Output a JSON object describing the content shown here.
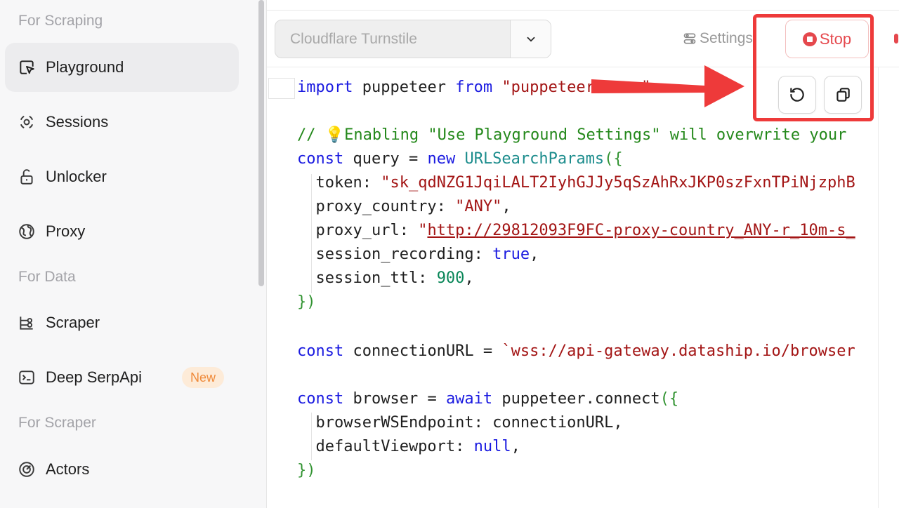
{
  "sidebar": {
    "sections": {
      "scraping": "For Scraping",
      "data": "For Data",
      "scraper": "For Scraper"
    },
    "items": [
      {
        "label": "Playground",
        "icon": "cursor-pointer-icon",
        "active": true
      },
      {
        "label": "Sessions",
        "icon": "sessions-icon"
      },
      {
        "label": "Unlocker",
        "icon": "unlock-icon"
      },
      {
        "label": "Proxy",
        "icon": "globe-icon"
      },
      {
        "label": "Scraper",
        "icon": "scraper-icon"
      },
      {
        "label": "Deep SerpApi",
        "icon": "terminal-icon",
        "badge": "New"
      },
      {
        "label": "Actors",
        "icon": "actors-icon"
      }
    ]
  },
  "toolbar": {
    "select_value": "Cloudflare Turnstile",
    "settings_label": "Settings",
    "stop_label": "Stop",
    "reset_icon": "reset-icon",
    "copy_icon": "copy-icon"
  },
  "code": {
    "l1": {
      "kw1": "import",
      "plain1": " puppeteer ",
      "kw2": "from",
      "str": " \"puppeteer-core\""
    },
    "l2": {
      "comment": "// 💡Enabling \"Use Playground Settings\" will overwrite your"
    },
    "l3": {
      "kw": "const",
      "plain": " query = ",
      "kw2": "new",
      "cls": " URLSearchParams",
      "brace": "({"
    },
    "l4": {
      "key": "  token: ",
      "str": "\"sk_qdNZG1JqiLALT2IyhGJJy5qSzAhRxJKP0szFxnTPiNjzphB"
    },
    "l5": {
      "key": "  proxy_country: ",
      "str": "\"ANY\"",
      "tail": ","
    },
    "l6": {
      "key": "  proxy_url: ",
      "q": "\"",
      "url": "http://29812093F9FC-proxy-country_ANY-r_10m-s_"
    },
    "l7": {
      "key": "  session_recording: ",
      "kw": "true",
      "tail": ","
    },
    "l8": {
      "key": "  session_ttl: ",
      "num": "900",
      "tail": ","
    },
    "l9": {
      "brace": "})"
    },
    "l10": {
      "kw": "const",
      "plain": " connectionURL = ",
      "str": "`wss://api-gateway.dataship.io/browser"
    },
    "l11": {
      "kw": "const",
      "plain": " browser = ",
      "kw2": "await",
      "plain2": " puppeteer.connect",
      "brace": "({"
    },
    "l12": {
      "key": "  browserWSEndpoint: connectionURL,"
    },
    "l13": {
      "key": "  defaultViewport: ",
      "kw": "null",
      "tail": ","
    },
    "l14": {
      "brace": "})"
    }
  },
  "colors": {
    "accent_red": "#e5484d",
    "annotation_red": "#ee3a3a",
    "badge_orange": "#ef8a3a"
  }
}
